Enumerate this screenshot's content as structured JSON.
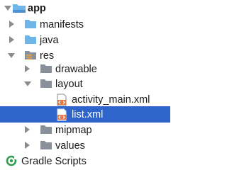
{
  "tree": {
    "app": "app",
    "manifests": "manifests",
    "java": "java",
    "res": "res",
    "drawable": "drawable",
    "layout": "layout",
    "activity_main": "activity_main.xml",
    "list_xml": "list.xml",
    "mipmap": "mipmap",
    "values": "values",
    "gradle_scripts": "Gradle Scripts"
  },
  "colors": {
    "selection": "#2f65ca",
    "folder_blue": "#6fb6e8",
    "folder_gray": "#8a9099",
    "gradle_green": "#2e9c4e",
    "xml_orange": "#e2794b"
  },
  "icons": {
    "module": "module-folder-icon",
    "folder": "folder-icon",
    "resource_folder": "resource-folder-icon",
    "xml_file": "xml-file-icon",
    "gradle": "gradle-icon"
  }
}
